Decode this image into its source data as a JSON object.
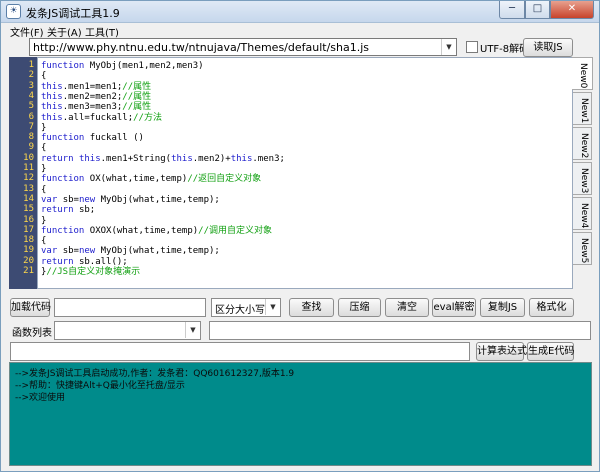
{
  "window": {
    "title": "发条JS调试工具1.9",
    "minimize": "─",
    "maximize": "□",
    "close": "✕",
    "icon": "app-icon"
  },
  "menu": [
    "文件(F)",
    "关于(A)",
    "工具(T)"
  ],
  "url": {
    "value": "http://www.phy.ntnu.edu.tw/ntnujava/Themes/default/sha1.js",
    "checkbox_label": "UTF-8解码",
    "read_button": "读取JS"
  },
  "editor": {
    "line_numbers": [
      "1",
      "2",
      "3",
      "4",
      "5",
      "6",
      "7",
      "8",
      "9",
      "10",
      "11",
      "12",
      "13",
      "14",
      "15",
      "16",
      "17",
      "18",
      "19",
      "20",
      "21"
    ],
    "lines": [
      [
        {
          "t": "function ",
          "c": "kw"
        },
        {
          "t": "MyObj(men1,men2,men3)",
          "c": ""
        }
      ],
      [
        {
          "t": "{",
          "c": ""
        }
      ],
      [
        {
          "t": "this",
          "c": "kw"
        },
        {
          "t": ".men1=men1;",
          "c": ""
        },
        {
          "t": "//属性",
          "c": "cm"
        }
      ],
      [
        {
          "t": "this",
          "c": "kw"
        },
        {
          "t": ".men2=men2;",
          "c": ""
        },
        {
          "t": "//属性",
          "c": "cm"
        }
      ],
      [
        {
          "t": "this",
          "c": "kw"
        },
        {
          "t": ".men3=men3;",
          "c": ""
        },
        {
          "t": "//属性",
          "c": "cm"
        }
      ],
      [
        {
          "t": "this",
          "c": "kw"
        },
        {
          "t": ".all=fuckall;",
          "c": ""
        },
        {
          "t": "//方法",
          "c": "cm"
        }
      ],
      [
        {
          "t": "}",
          "c": ""
        }
      ],
      [
        {
          "t": "function ",
          "c": "kw"
        },
        {
          "t": "fuckall ()",
          "c": ""
        }
      ],
      [
        {
          "t": "{",
          "c": ""
        }
      ],
      [
        {
          "t": "return ",
          "c": "kw"
        },
        {
          "t": "this",
          "c": "kw"
        },
        {
          "t": ".men1+String(",
          "c": ""
        },
        {
          "t": "this",
          "c": "kw"
        },
        {
          "t": ".men2)+",
          "c": ""
        },
        {
          "t": "this",
          "c": "kw"
        },
        {
          "t": ".men3;",
          "c": ""
        }
      ],
      [
        {
          "t": "}",
          "c": ""
        }
      ],
      [
        {
          "t": "function ",
          "c": "kw"
        },
        {
          "t": "OX(what,time,temp)",
          "c": ""
        },
        {
          "t": "//返回自定义对象",
          "c": "cm"
        }
      ],
      [
        {
          "t": "{",
          "c": ""
        }
      ],
      [
        {
          "t": "var ",
          "c": "kw"
        },
        {
          "t": "sb=",
          "c": ""
        },
        {
          "t": "new ",
          "c": "kw"
        },
        {
          "t": "MyObj(what,time,temp);",
          "c": ""
        }
      ],
      [
        {
          "t": "return ",
          "c": "kw"
        },
        {
          "t": "sb;",
          "c": ""
        }
      ],
      [
        {
          "t": "}",
          "c": ""
        }
      ],
      [
        {
          "t": "function ",
          "c": "kw"
        },
        {
          "t": "OXOX(what,time,temp)",
          "c": ""
        },
        {
          "t": "//调用自定义对象",
          "c": "cm"
        }
      ],
      [
        {
          "t": "{",
          "c": ""
        }
      ],
      [
        {
          "t": "var ",
          "c": "kw"
        },
        {
          "t": "sb=",
          "c": ""
        },
        {
          "t": "new ",
          "c": "kw"
        },
        {
          "t": "MyObj(what,time,temp);",
          "c": ""
        }
      ],
      [
        {
          "t": "return ",
          "c": "kw"
        },
        {
          "t": "sb.all();",
          "c": ""
        }
      ],
      [
        {
          "t": "}",
          "c": ""
        },
        {
          "t": "//JS自定义对象掩演示",
          "c": "cm"
        }
      ]
    ]
  },
  "tabs": [
    "New0",
    "New1",
    "New2",
    "New3",
    "New4",
    "New5"
  ],
  "toolbar": {
    "load_button": "加载代码",
    "case_select": "区分大小写",
    "find": "查找",
    "compress": "压缩",
    "clear": "清空",
    "eval_decode": "eval解密",
    "copy_js": "复制JS",
    "format": "格式化"
  },
  "functions": {
    "label": "函数列表"
  },
  "expr": {
    "calc_button": "计算表达式",
    "gen_button": "生成E代码"
  },
  "output": {
    "lines": [
      "-->发条JS调试工具启动成功,作者：发条君：QQ601612327,版本1.9",
      "-->帮助：快捷键Alt+Q最小化至托盘/显示",
      "-->欢迎使用"
    ],
    "background": "#008b8b"
  }
}
